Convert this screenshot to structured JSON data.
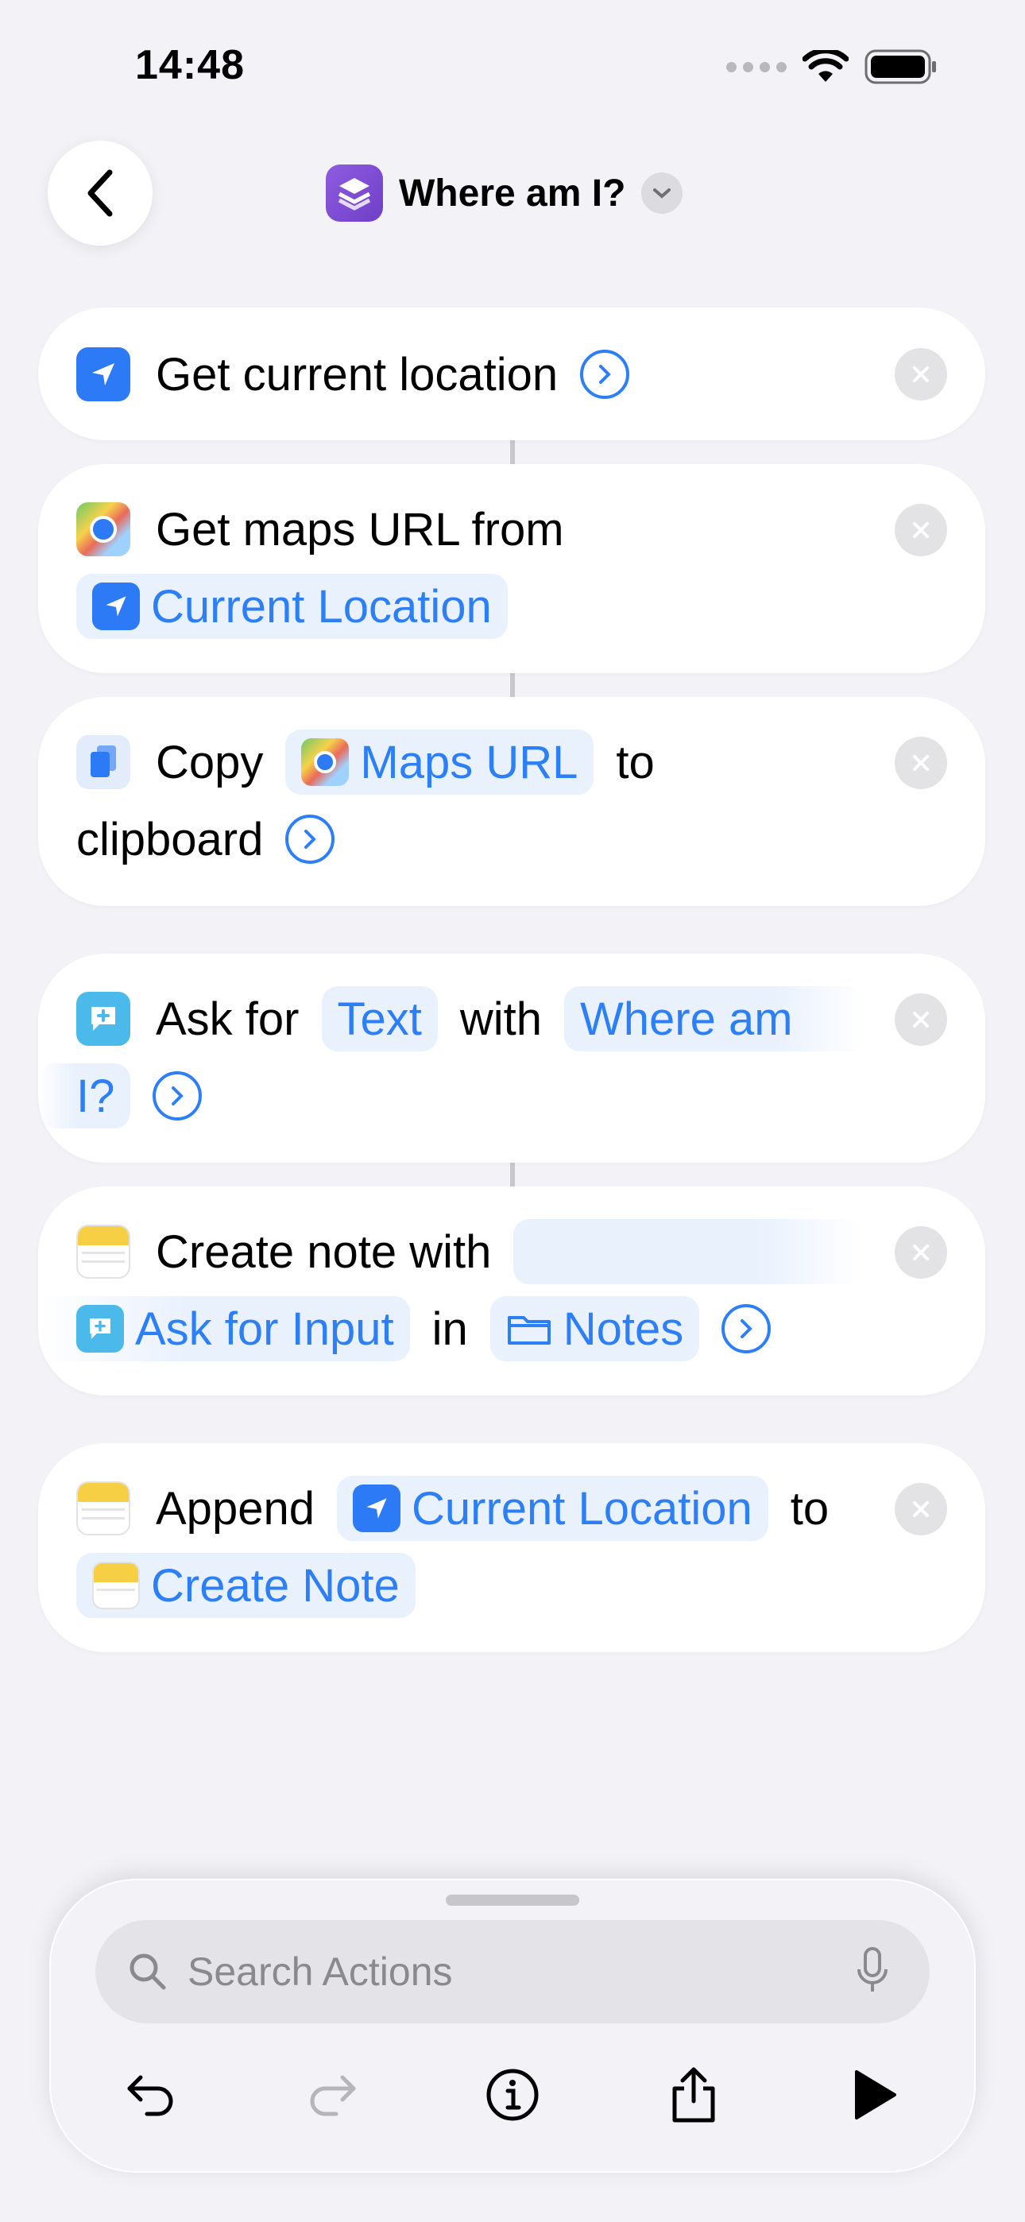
{
  "status_bar": {
    "time": "14:48"
  },
  "nav": {
    "title": "Where am I?"
  },
  "actions": [
    {
      "text": "Get current location"
    },
    {
      "text": "Get maps URL from",
      "input_token": "Current Location"
    },
    {
      "verb": "Copy",
      "token": "Maps URL",
      "connector": "to",
      "object": "clipboard"
    },
    {
      "verb": "Ask for",
      "type_token": "Text",
      "connector": "with",
      "prompt_token_line1": "Where am",
      "prompt_token_line2": "I?"
    },
    {
      "verb": "Create note with",
      "input_token": "Ask for Input",
      "connector": "in",
      "folder_token": "Notes"
    },
    {
      "verb": "Append",
      "input_token": "Current Location",
      "connector": "to",
      "target_token": "Create Note"
    }
  ],
  "search": {
    "placeholder": "Search Actions"
  },
  "icons": {
    "back": "chevron-left-icon",
    "app": "layers-icon",
    "location": "location-arrow-icon",
    "maps": "maps-icon",
    "copy": "documents-icon",
    "ask": "chat-plus-icon",
    "note": "notes-icon",
    "folder": "folder-icon",
    "remove": "xmark-icon",
    "search": "magnifier-icon",
    "mic": "microphone-icon",
    "undo": "undo-icon",
    "redo": "redo-icon",
    "info": "info-icon",
    "share": "share-icon",
    "run": "play-icon"
  },
  "colors": {
    "accent": "#2c7ff6",
    "location_icon": "#2c7af5",
    "background": "#f2f2f7",
    "card": "#ffffff",
    "app_icon": "#7b4bd6"
  }
}
